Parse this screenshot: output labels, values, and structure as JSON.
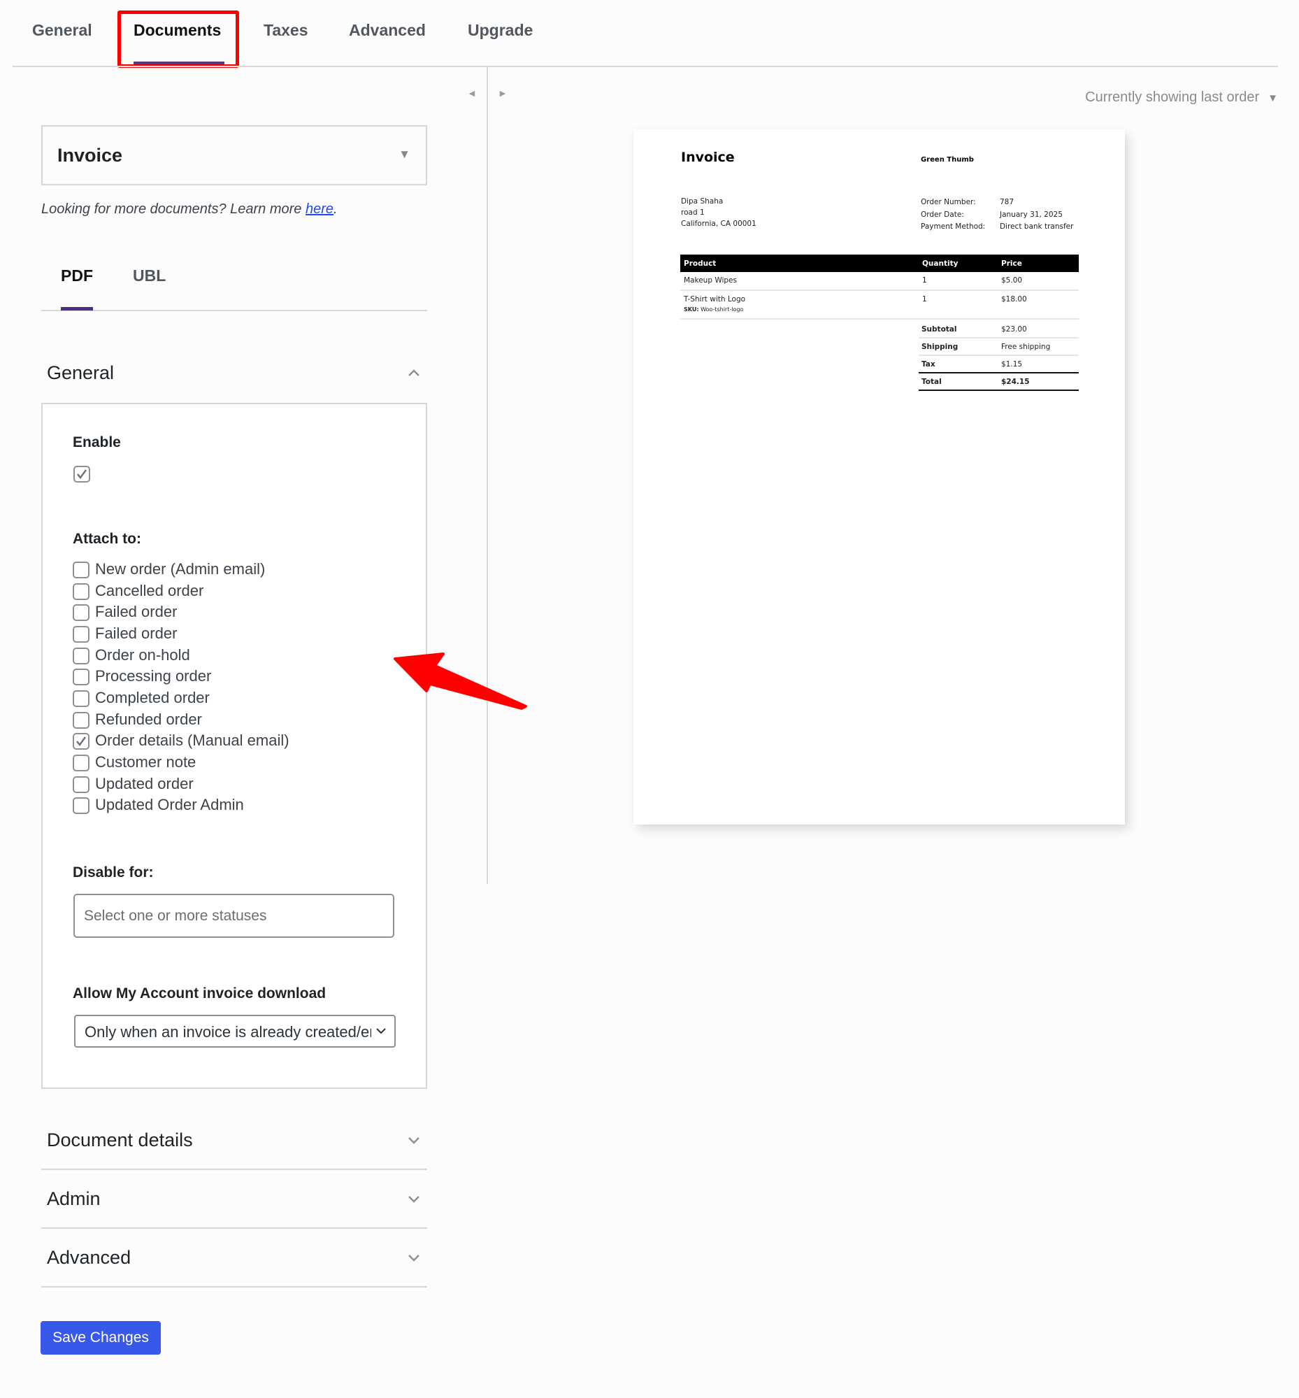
{
  "top_tabs": [
    {
      "label": "General",
      "active": false
    },
    {
      "label": "Documents",
      "active": true
    },
    {
      "label": "Taxes",
      "active": false
    },
    {
      "label": "Advanced",
      "active": false
    },
    {
      "label": "Upgrade",
      "active": false
    }
  ],
  "preview_nav": {
    "prev_icon": "◄",
    "next_icon": "►",
    "order_selector": "Currently showing last order",
    "order_selector_caret": "▼"
  },
  "document_select": {
    "value": "Invoice",
    "caret": "▼"
  },
  "more_documents": {
    "text": "Looking for more documents? Learn more ",
    "link": "here",
    "suffix": "."
  },
  "format_tabs": [
    {
      "label": "PDF",
      "active": true
    },
    {
      "label": "UBL",
      "active": false
    }
  ],
  "sections": {
    "general": {
      "title": "General",
      "expanded": true,
      "enable_label": "Enable",
      "enable_checked": true,
      "attach_label": "Attach to:",
      "attach_options": [
        {
          "label": "New order (Admin email)",
          "checked": false
        },
        {
          "label": "Cancelled order",
          "checked": false
        },
        {
          "label": "Failed order",
          "checked": false
        },
        {
          "label": "Failed order",
          "checked": false
        },
        {
          "label": "Order on-hold",
          "checked": false
        },
        {
          "label": "Processing order",
          "checked": false
        },
        {
          "label": "Completed order",
          "checked": false
        },
        {
          "label": "Refunded order",
          "checked": false
        },
        {
          "label": "Order details (Manual email)",
          "checked": true
        },
        {
          "label": "Customer note",
          "checked": false
        },
        {
          "label": "Updated order",
          "checked": false
        },
        {
          "label": "Updated Order Admin",
          "checked": false
        }
      ],
      "disable_label": "Disable for:",
      "disable_placeholder": "Select one or more statuses",
      "download_label": "Allow My Account invoice download",
      "download_value": "Only when an invoice is already created/emailed"
    },
    "document_details": {
      "title": "Document details",
      "expanded": false
    },
    "admin": {
      "title": "Admin",
      "expanded": false
    },
    "advanced": {
      "title": "Advanced",
      "expanded": false
    }
  },
  "save_button": "Save Changes",
  "invoice_preview": {
    "title": "Invoice",
    "shop_name": "Green Thumb",
    "billing_address": [
      "Dipa Shaha",
      "road 1",
      "California, CA 00001"
    ],
    "meta": [
      {
        "key": "Order Number:",
        "value": "787"
      },
      {
        "key": "Order Date:",
        "value": "January 31, 2025"
      },
      {
        "key": "Payment Method:",
        "value": "Direct bank transfer"
      }
    ],
    "columns": [
      "Product",
      "Quantity",
      "Price"
    ],
    "items": [
      {
        "product": "Makeup Wipes",
        "sku": "",
        "quantity": "1",
        "price": "$5.00"
      },
      {
        "product": "T-Shirt with Logo",
        "sku_label": "SKU:",
        "sku": "Woo-tshirt-logo",
        "quantity": "1",
        "price": "$18.00"
      }
    ],
    "totals": [
      {
        "key": "Subtotal",
        "value": "$23.00"
      },
      {
        "key": "Shipping",
        "value": "Free shipping"
      },
      {
        "key": "Tax",
        "value": "$1.15"
      },
      {
        "key": "Total",
        "value": "$24.15"
      }
    ]
  },
  "annotation": {
    "highlight_color": "#ff0000",
    "arrow_color": "#ff0000"
  },
  "colors": {
    "primary_button": "#3858e9",
    "tab_underline": "#4f2d7f",
    "link": "#2249ea"
  }
}
